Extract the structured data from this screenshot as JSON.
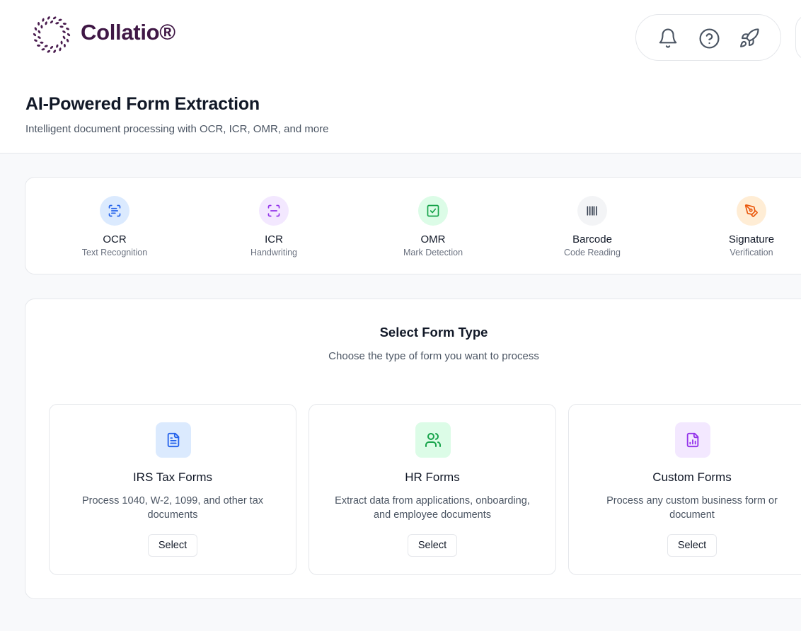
{
  "brand": {
    "name": "Collatio®"
  },
  "header": {
    "tools": [
      {
        "name": "notifications",
        "icon": "bell-icon"
      },
      {
        "name": "help",
        "icon": "question-circle-icon"
      },
      {
        "name": "launch",
        "icon": "rocket-icon"
      }
    ]
  },
  "page": {
    "title": "AI-Powered Form Extraction",
    "subtitle": "Intelligent document processing with OCR, ICR, OMR, and more"
  },
  "capabilities": [
    {
      "name": "OCR",
      "desc": "Text Recognition",
      "icon": "text-scan-icon",
      "bg": "#dbeafe",
      "fg": "#2563eb"
    },
    {
      "name": "ICR",
      "desc": "Handwriting",
      "icon": "scan-icon",
      "bg": "#f3e8ff",
      "fg": "#9333ea"
    },
    {
      "name": "OMR",
      "desc": "Mark Detection",
      "icon": "checkbox-icon",
      "bg": "#dcfce7",
      "fg": "#16a34a"
    },
    {
      "name": "Barcode",
      "desc": "Code Reading",
      "icon": "barcode-icon",
      "bg": "#f3f4f6",
      "fg": "#374151"
    },
    {
      "name": "Signature",
      "desc": "Verification",
      "icon": "pen-tool-icon",
      "bg": "#ffedd5",
      "fg": "#ea580c"
    }
  ],
  "form_section": {
    "title": "Select Form Type",
    "subtitle": "Choose the type of form you want to process",
    "types": [
      {
        "name": "IRS Tax Forms",
        "desc": "Process 1040, W-2, 1099, and other tax documents",
        "button": "Select",
        "icon": "document-icon",
        "bg": "#dbeafe",
        "fg": "#2563eb"
      },
      {
        "name": "HR Forms",
        "desc": "Extract data from applications, onboarding, and employee documents",
        "button": "Select",
        "icon": "users-icon",
        "bg": "#dcfce7",
        "fg": "#16a34a"
      },
      {
        "name": "Custom Forms",
        "desc": "Process any custom business form or document",
        "button": "Select",
        "icon": "chart-file-icon",
        "bg": "#f3e8ff",
        "fg": "#9333ea"
      }
    ]
  }
}
